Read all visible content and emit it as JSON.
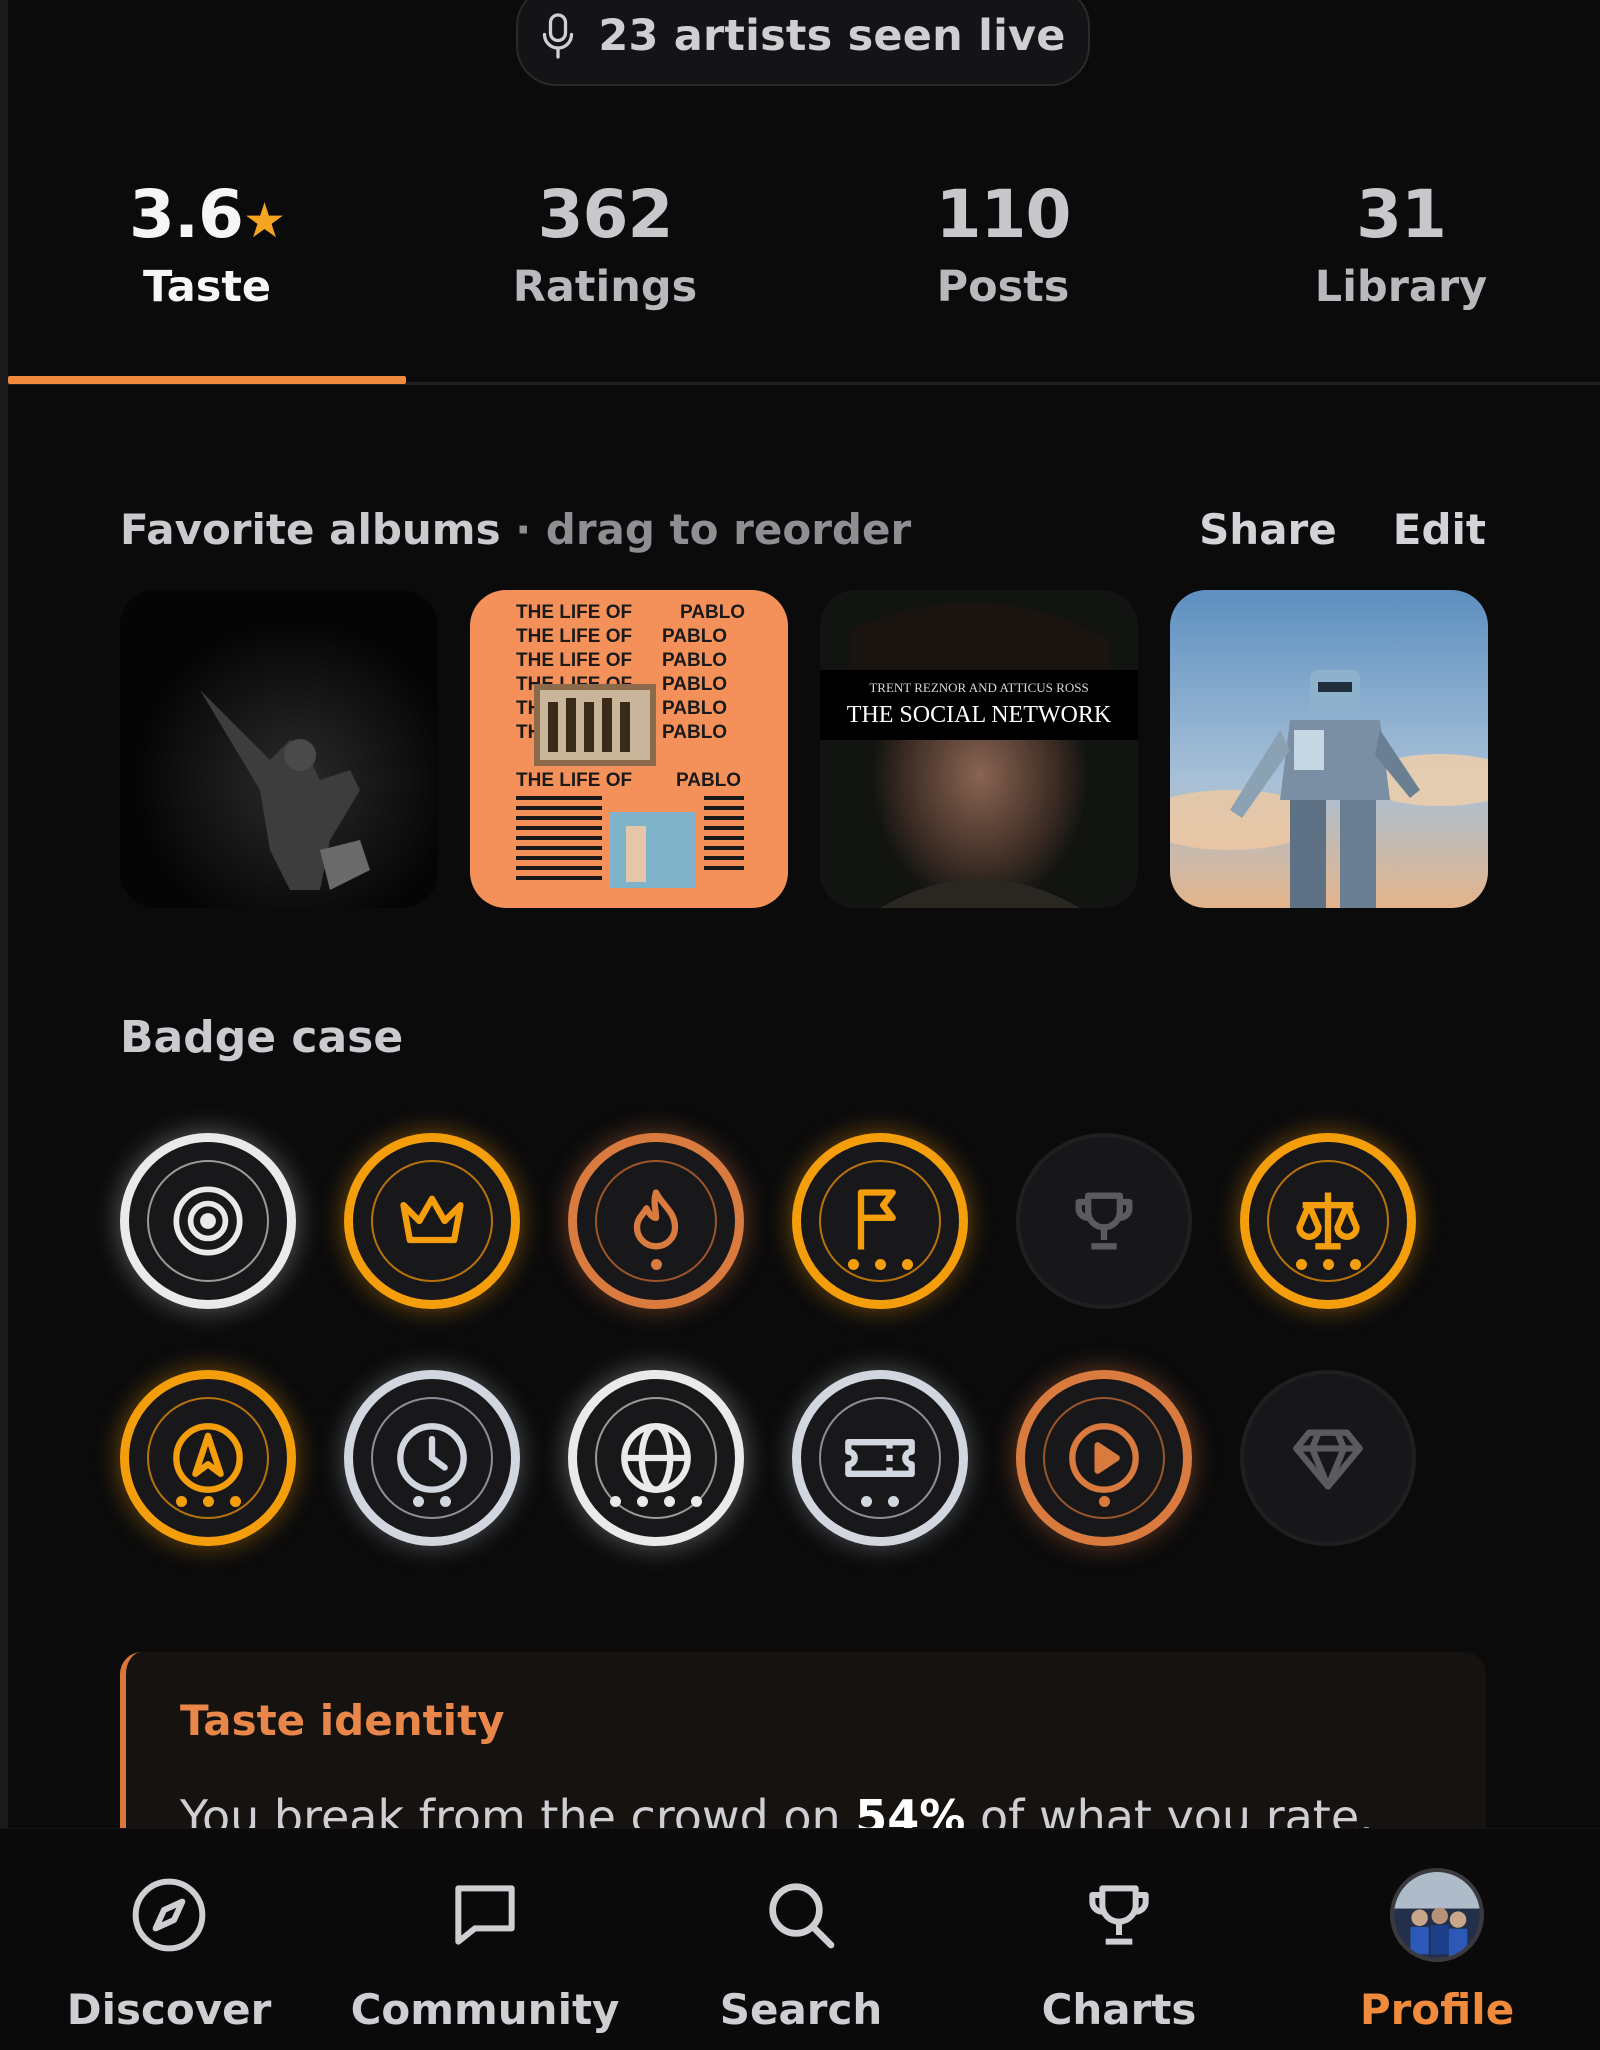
{
  "live": {
    "text": "23 artists seen live",
    "icon": "microphone-icon"
  },
  "stats": [
    {
      "value": "3.6",
      "label": "Taste",
      "star": "★",
      "active": true
    },
    {
      "value": "362",
      "label": "Ratings"
    },
    {
      "value": "110",
      "label": "Posts"
    },
    {
      "value": "31",
      "label": "Library"
    }
  ],
  "favorites": {
    "title": "Favorite albums",
    "subtitle": " · drag to reorder",
    "share_label": "Share",
    "edit_label": "Edit",
    "albums": [
      {
        "name": "dark-figure-album-cover"
      },
      {
        "name": "the-life-of-pablo-cover",
        "lines": [
          "THE LIFE OF",
          "PABLO"
        ]
      },
      {
        "name": "the-social-network-cover",
        "credit": "TRENT REZNOR AND ATTICUS ROSS",
        "title": "THE SOCIAL NETWORK"
      },
      {
        "name": "robot-album-cover"
      }
    ]
  },
  "badges": {
    "title": "Badge case",
    "row1": [
      {
        "name": "target-badge",
        "tier": "white",
        "icon": "target-icon",
        "dots": 0
      },
      {
        "name": "crown-badge",
        "tier": "gold",
        "icon": "crown-icon",
        "dots": 0
      },
      {
        "name": "flame-badge",
        "tier": "bronze",
        "icon": "flame-icon",
        "dots": 1
      },
      {
        "name": "flag-badge",
        "tier": "gold",
        "icon": "flag-icon",
        "dots": 3
      },
      {
        "name": "trophy-badge",
        "tier": "locked",
        "icon": "trophy-icon",
        "dots": 0
      },
      {
        "name": "scales-badge",
        "tier": "gold",
        "icon": "scales-icon",
        "dots": 3
      }
    ],
    "row2": [
      {
        "name": "compass-badge",
        "tier": "gold",
        "icon": "navigation-arrow-icon",
        "dots": 3
      },
      {
        "name": "clock-badge",
        "tier": "silver",
        "icon": "clock-icon",
        "dots": 2
      },
      {
        "name": "globe-badge",
        "tier": "white",
        "icon": "globe-icon",
        "dots": 4
      },
      {
        "name": "ticket-badge",
        "tier": "silver",
        "icon": "ticket-icon",
        "dots": 2
      },
      {
        "name": "play-badge",
        "tier": "bronze",
        "icon": "play-icon",
        "dots": 1
      },
      {
        "name": "diamond-badge",
        "tier": "locked",
        "icon": "diamond-icon",
        "dots": 0
      }
    ],
    "colors": {
      "gold": "#f59e0b",
      "bronze": "#d97a3e",
      "silver": "#d2d6de",
      "white": "#eaeaea",
      "locked": "#5a5a5f"
    }
  },
  "taste_identity": {
    "title": "Taste identity",
    "text_before": "You break from the crowd on ",
    "percent": "54%",
    "text_after": " of what you rate."
  },
  "nav": [
    {
      "label": "Discover",
      "icon": "compass-icon"
    },
    {
      "label": "Community",
      "icon": "chat-bubble-icon"
    },
    {
      "label": "Search",
      "icon": "search-icon"
    },
    {
      "label": "Charts",
      "icon": "trophy-icon"
    },
    {
      "label": "Profile",
      "icon": "avatar",
      "active": true
    }
  ],
  "colors": {
    "accent": "#f08a3c",
    "background": "#0b0b0c"
  }
}
